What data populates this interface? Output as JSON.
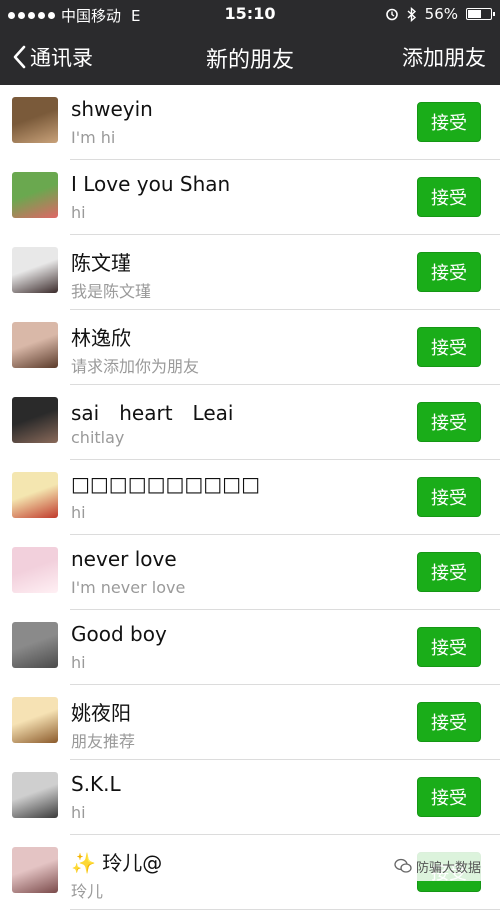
{
  "status_bar": {
    "carrier": "中国移动",
    "network": "E",
    "time": "15:10",
    "battery": "56%",
    "battery_level": 0.56
  },
  "nav": {
    "back_label": "通讯录",
    "title": "新的朋友",
    "action_label": "添加朋友"
  },
  "accept_label": "接受",
  "requests": [
    {
      "name": "shweyin",
      "message": "I'm hi",
      "avatar_colors": [
        "#7a5a3a",
        "#c9a27a"
      ]
    },
    {
      "name": "I Love you Shan",
      "message": "hi",
      "avatar_colors": [
        "#6aa84f",
        "#e06666"
      ]
    },
    {
      "name": "陈文瑾",
      "message": "我是陈文瑾",
      "avatar_colors": [
        "#e8e8e8",
        "#3a2a2a"
      ]
    },
    {
      "name": "林逸欣",
      "message": "请求添加你为朋友",
      "avatar_colors": [
        "#d9b8a8",
        "#5a3a2a"
      ]
    },
    {
      "name": "sai　heart　Leai",
      "message": "chitlay",
      "avatar_colors": [
        "#2a2a2a",
        "#8a6a5a"
      ]
    },
    {
      "name": "□□□□□□□□□□",
      "message": "hi",
      "avatar_colors": [
        "#f4e6b0",
        "#c0392b"
      ]
    },
    {
      "name": "never love",
      "message": "I'm never love",
      "avatar_colors": [
        "#f2d0dc",
        "#fff0f4"
      ]
    },
    {
      "name": "Good boy",
      "message": "hi",
      "avatar_colors": [
        "#8a8a8a",
        "#4a4a4a"
      ]
    },
    {
      "name": "姚夜阳",
      "message": "朋友推荐",
      "avatar_colors": [
        "#f6e2b4",
        "#8b5a2b"
      ]
    },
    {
      "name": "S.K.L",
      "message": "hi",
      "avatar_colors": [
        "#cfcfcf",
        "#3a3a3a"
      ]
    },
    {
      "name": "✨ 玲儿@",
      "message": "玲儿",
      "avatar_colors": [
        "#e4c4c4",
        "#7a4a4a"
      ]
    }
  ],
  "watermark": "防骗大数据"
}
